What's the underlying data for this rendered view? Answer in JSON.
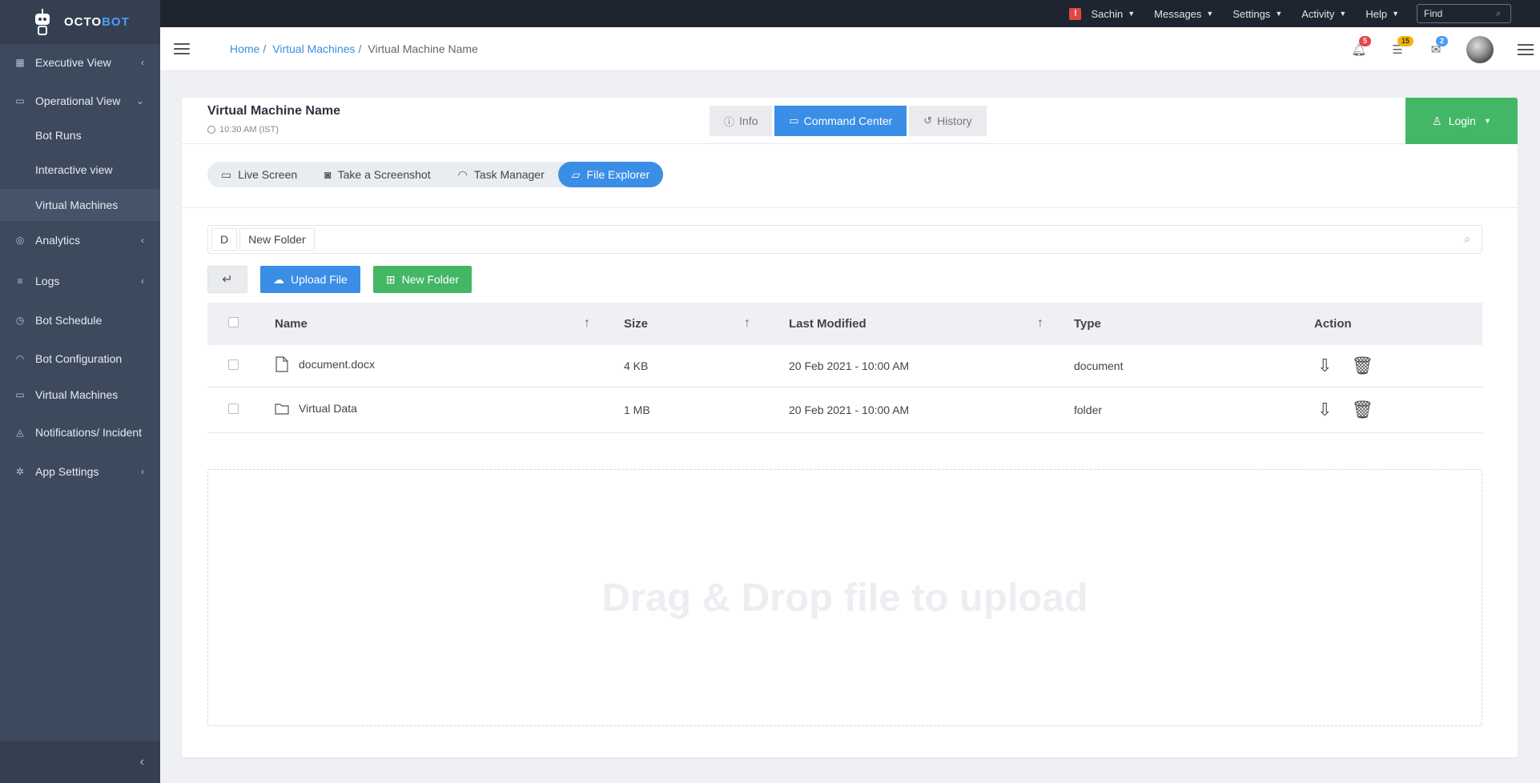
{
  "brand": {
    "name_a": "OCTO",
    "name_b": "BOT",
    "accent": "#4a9df8"
  },
  "sidebar": {
    "items": [
      {
        "label": "Executive View",
        "icon": "grid-icon",
        "chevron": "‹"
      },
      {
        "label": "Operational View",
        "icon": "monitor-icon",
        "chevron": "⌄"
      },
      {
        "label": "Bot Runs",
        "sub": true
      },
      {
        "label": "Interactive view",
        "sub": true
      },
      {
        "label": "Virtual Machines",
        "sub": true
      },
      {
        "label": "Analytics",
        "icon": "analytics-icon",
        "chevron": "‹"
      },
      {
        "label": "Logs",
        "icon": "logs-icon",
        "chevron": "‹"
      },
      {
        "label": "Bot Schedule",
        "icon": "clock-icon"
      },
      {
        "label": "Bot Configuration",
        "icon": "gauge-icon"
      },
      {
        "label": "Virtual Machines",
        "icon": "desktop-icon"
      },
      {
        "label": "Notifications/ Incident",
        "icon": "bell-icon"
      },
      {
        "label": "App Settings",
        "icon": "gear-icon",
        "chevron": "‹"
      }
    ],
    "collapse_glyph": "‹"
  },
  "topbar": {
    "alert": "!",
    "user": "Sachin",
    "menus": [
      "Messages",
      "Settings",
      "Activity",
      "Help"
    ],
    "find_placeholder": "Find"
  },
  "header": {
    "breadcrumb": {
      "home": "Home",
      "section": "Virtual Machines",
      "current": "Virtual Machine Name"
    },
    "badges": {
      "notifications": "5",
      "tasks": "15",
      "messages": "2"
    },
    "colors": {
      "notifications": "#e64545",
      "tasks": "#f5b400",
      "messages": "#4a9df8"
    }
  },
  "card": {
    "title": "Virtual Machine Name",
    "time": "10:30 AM (IST)",
    "tabs": [
      "Info",
      "Command Center",
      "History"
    ],
    "login": "Login",
    "subtabs": [
      "Live Screen",
      "Take a Screenshot",
      "Task Manager",
      "File Explorer"
    ]
  },
  "explorer": {
    "path": [
      "D",
      "New Folder"
    ],
    "upload": "Upload File",
    "new_folder": "New Folder",
    "columns": {
      "name": "Name",
      "size": "Size",
      "modified": "Last Modified",
      "type": "Type",
      "action": "Action"
    },
    "rows": [
      {
        "name": "document.docx",
        "size": "4 KB",
        "modified": "20 Feb 2021 - 10:00 AM",
        "type": "document",
        "icon": "file-icon"
      },
      {
        "name": "Virtual Data",
        "size": "1 MB",
        "modified": "20 Feb 2021 - 10:00 AM",
        "type": "folder",
        "icon": "folder-icon"
      }
    ],
    "dropzone": "Drag & Drop file to upload"
  }
}
